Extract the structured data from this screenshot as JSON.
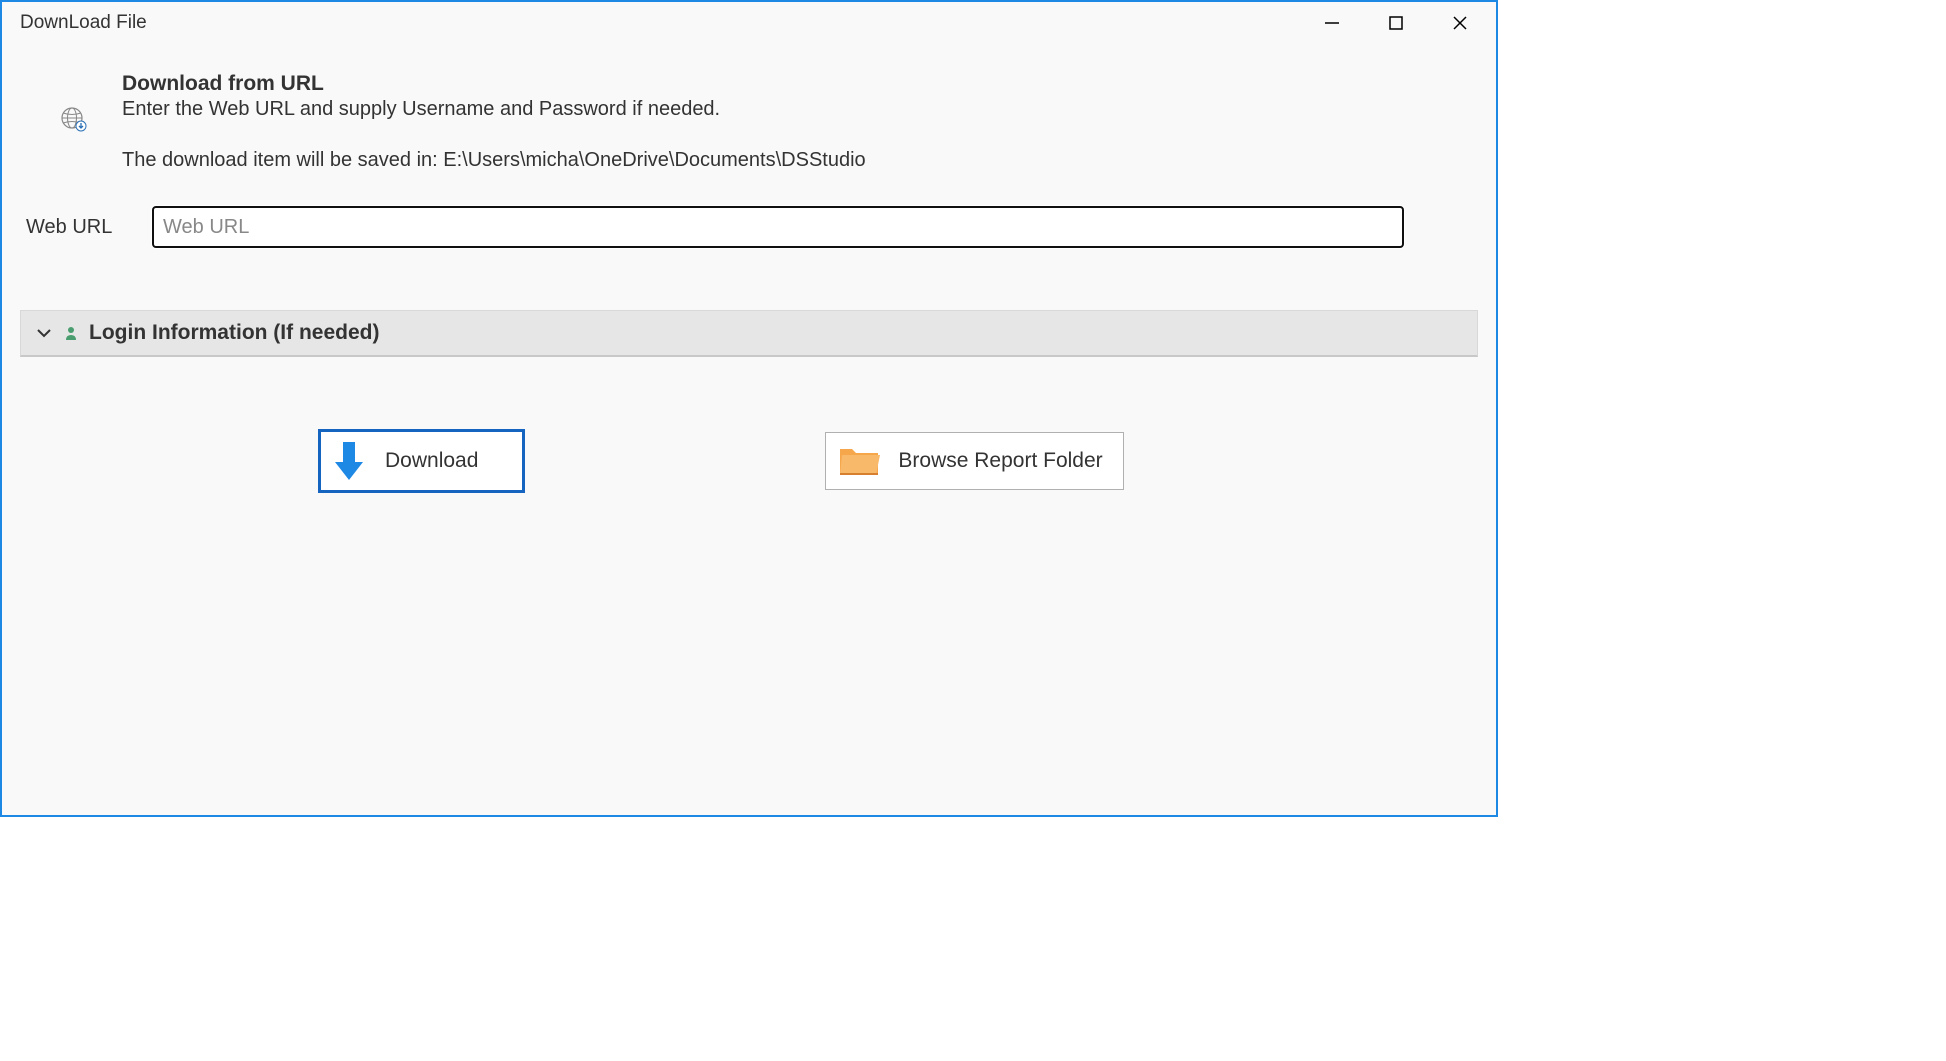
{
  "window": {
    "title": "DownLoad File"
  },
  "header": {
    "title": "Download from URL",
    "instruction": "Enter the Web URL and supply Username and Password if needed.",
    "save_path_label": "The download item will be saved in: E:\\Users\\micha\\OneDrive\\Documents\\DSStudio"
  },
  "url_section": {
    "label": "Web URL",
    "placeholder": "Web URL",
    "value": ""
  },
  "expander": {
    "title": "Login Information (If needed)"
  },
  "buttons": {
    "download_label": "Download",
    "browse_folder_label": "Browse Report Folder"
  }
}
